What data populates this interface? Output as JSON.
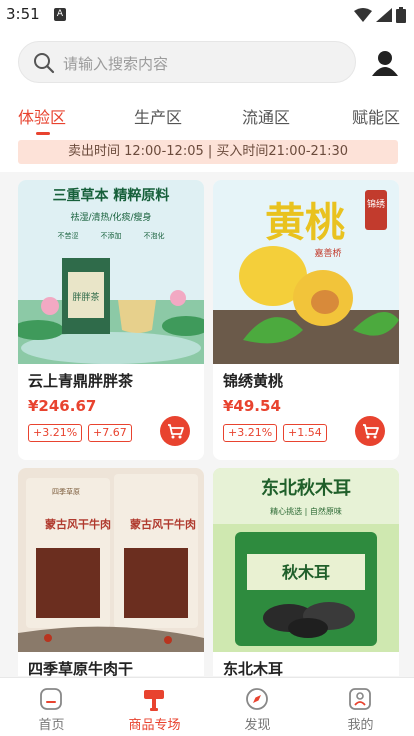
{
  "status_bar": {
    "time": "3:51",
    "notification_letter": "A"
  },
  "search": {
    "placeholder": "请输入搜索内容"
  },
  "tabs": [
    {
      "label": "体验区",
      "active": true
    },
    {
      "label": "生产区",
      "active": false
    },
    {
      "label": "流通区",
      "active": false
    },
    {
      "label": "赋能区",
      "active": false
    }
  ],
  "time_banner": "卖出时间 12:00-12:05 | 买入时间21:00-21:30",
  "products": [
    {
      "name": "云上青鼎胖胖茶",
      "price": "¥246.67",
      "tags": [
        "+3.21%",
        "+7.67"
      ],
      "image_text": {
        "title": "三重草本 精粹原料",
        "line": "祛湿/清热/化痰/瘦身",
        "labels": [
          "不苦涩",
          "不添加",
          "不泡化"
        ],
        "box": "胖胖茶"
      }
    },
    {
      "name": "锦绣黄桃",
      "price": "¥49.54",
      "tags": [
        "+3.21%",
        "+1.54"
      ],
      "image_text": {
        "big": "黄桃",
        "seal": "锦绣",
        "small": "嘉善桥"
      }
    },
    {
      "name": "四季草原牛肉干",
      "price": "",
      "tags": [],
      "image_text": {
        "label": "蒙古风干牛肉",
        "small": "四季草原"
      }
    },
    {
      "name": "东北木耳",
      "price": "",
      "tags": [],
      "image_text": {
        "title": "东北秋木耳",
        "sub": "精心挑选 | 自然原味",
        "bag": "秋木耳"
      }
    }
  ],
  "bottom_nav": [
    {
      "label": "首页",
      "active": false
    },
    {
      "label": "商品专场",
      "active": true
    },
    {
      "label": "发现",
      "active": false
    },
    {
      "label": "我的",
      "active": false
    }
  ],
  "colors": {
    "accent": "#e8432f",
    "banner_bg": "#fde2d8"
  }
}
